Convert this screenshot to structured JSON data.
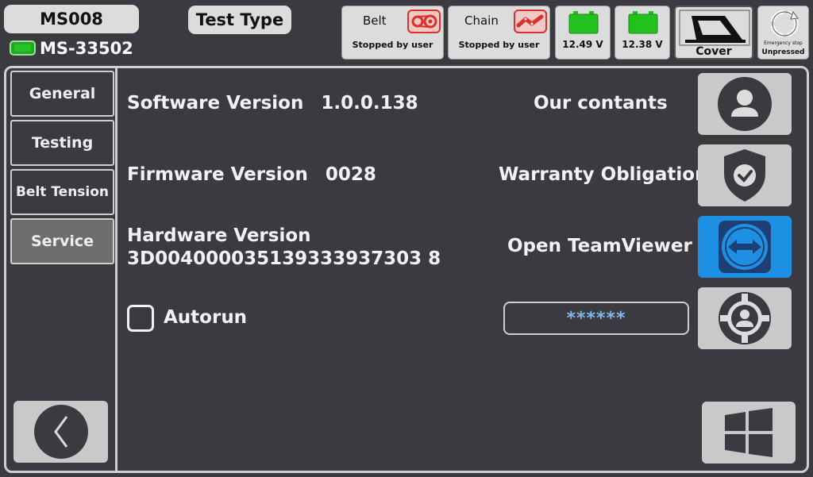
{
  "header": {
    "device_name": "MS008",
    "test_type_label": "Test Type",
    "serial": "MS-33502",
    "belt": {
      "label": "Belt",
      "status": "Stopped by user"
    },
    "chain": {
      "label": "Chain",
      "status": "Stopped by user"
    },
    "battery1": {
      "voltage": "12.49 V"
    },
    "battery2": {
      "voltage": "12.38 V"
    },
    "cover": {
      "label": "Cover"
    },
    "emergency": {
      "label": "Emergency stop",
      "status": "Unpressed"
    }
  },
  "sidebar": {
    "items": [
      {
        "label": "General",
        "active": false
      },
      {
        "label": "Testing",
        "active": false
      },
      {
        "label": "Belt Tension",
        "active": false
      },
      {
        "label": "Service",
        "active": true
      }
    ]
  },
  "info": {
    "software_label": "Software Version",
    "software_value": "1.0.0.138",
    "firmware_label": "Firmware Version",
    "firmware_value": "0028",
    "hardware_label": "Hardware Version",
    "hardware_value": "3D004000035139333937303 8",
    "autorun_label": "Autorun"
  },
  "actions": {
    "contacts_label": "Our contants",
    "warranty_label": "Warranty Obligation",
    "teamviewer_label": "Open TeamViewer",
    "password_value": "******"
  },
  "colors": {
    "background": "#3b3a40",
    "accent_blue": "#1e90e4",
    "battery_green": "#22c11e",
    "status_red": "#d9302a",
    "password_text": "#7fb6ee"
  }
}
